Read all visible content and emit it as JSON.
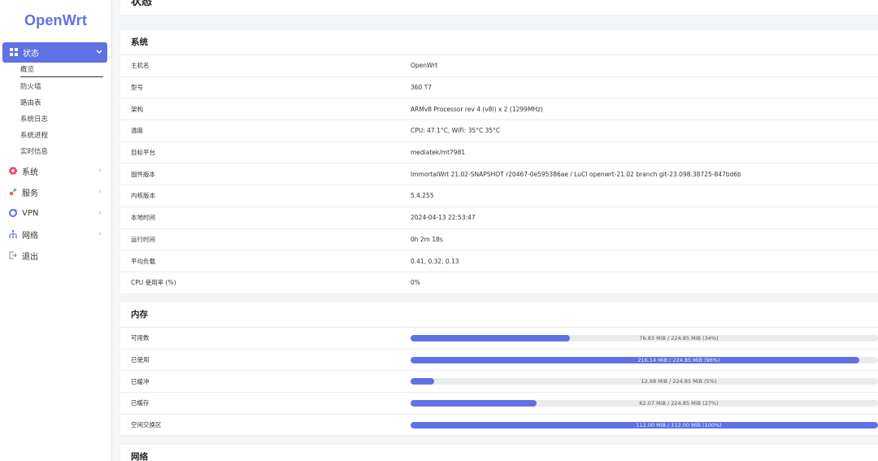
{
  "brand": "OpenWrt",
  "sidebar": {
    "active": {
      "label": "状态",
      "icon": "dashboard-icon"
    },
    "sub_items": [
      "概览",
      "防火墙",
      "路由表",
      "系统日志",
      "系统进程",
      "实时信息"
    ],
    "items": [
      {
        "label": "系统",
        "icon": "gear-icon",
        "color": "#f5365c"
      },
      {
        "label": "服务",
        "icon": "services-icon",
        "color": "#fb6340"
      },
      {
        "label": "VPN",
        "icon": "vpn-icon",
        "color": "#5e72e4"
      },
      {
        "label": "网络",
        "icon": "network-icon",
        "color": "#5e72e4"
      },
      {
        "label": "退出",
        "icon": "logout-icon",
        "color": "#888888"
      }
    ]
  },
  "page": {
    "title": "状态"
  },
  "system": {
    "title": "系统",
    "rows": [
      {
        "key": "主机名",
        "value": "OpenWrt"
      },
      {
        "key": "型号",
        "value": "360 T7"
      },
      {
        "key": "架构",
        "value": "ARMv8 Processor rev 4 (v8l) x 2 (1299MHz)"
      },
      {
        "key": "温度",
        "value": "CPU: 47.1°C, WiFi: 35°C 35°C"
      },
      {
        "key": "目标平台",
        "value": "mediatek/mt7981"
      },
      {
        "key": "固件版本",
        "value": "ImmortalWrt 21.02-SNAPSHOT r20467-0e595386ae / LuCI openwrt-21.02 branch git-23.098.38725-847bd6b"
      },
      {
        "key": "内核版本",
        "value": "5.4.255"
      },
      {
        "key": "本地时间",
        "value": "2024-04-13 22:53:47"
      },
      {
        "key": "运行时间",
        "value": "0h 2m 18s"
      },
      {
        "key": "平均负载",
        "value": "0.41, 0.32, 0.13"
      },
      {
        "key": "CPU 使用率 (%)",
        "value": "0%"
      }
    ]
  },
  "memory": {
    "title": "内存",
    "rows": [
      {
        "key": "可用数",
        "text": "76.83 MiB / 224.85 MiB (34%)",
        "percent": 34
      },
      {
        "key": "已使用",
        "text": "216.14 MiB / 224.85 MiB (96%)",
        "percent": 96
      },
      {
        "key": "已缓冲",
        "text": "12.68 MiB / 224.85 MiB (5%)",
        "percent": 5
      },
      {
        "key": "已缓存",
        "text": "62.07 MiB / 224.85 MiB (27%)",
        "percent": 27
      },
      {
        "key": "空闲交换区",
        "text": "112.00 MiB / 112.00 MiB (100%)",
        "percent": 100
      }
    ]
  },
  "network": {
    "title": "网络"
  },
  "colors": {
    "accent": "#5e72e4",
    "track": "#e9ecef"
  }
}
